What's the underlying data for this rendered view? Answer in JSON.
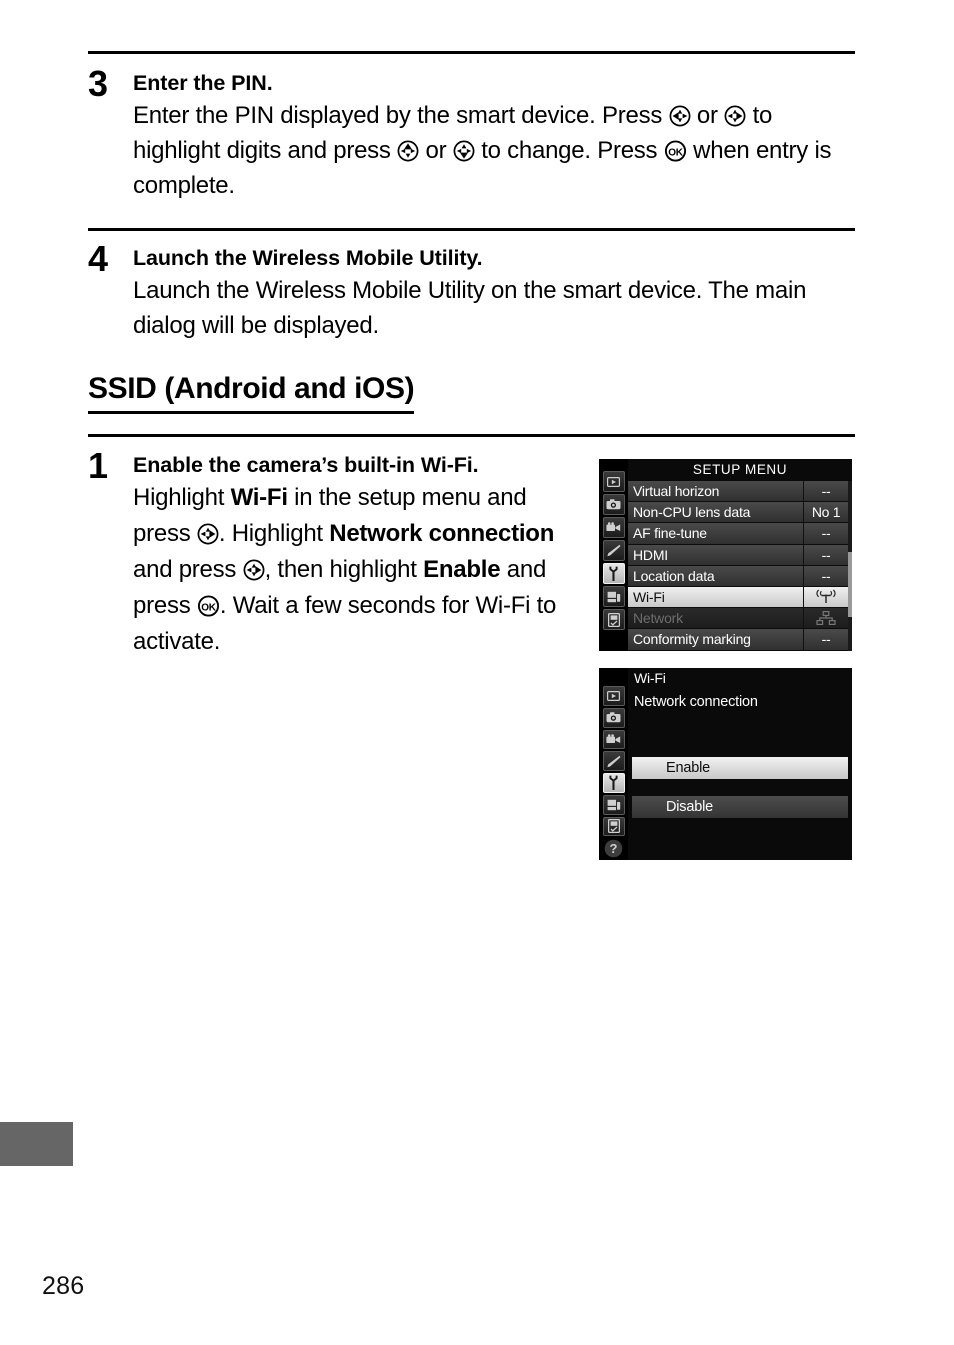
{
  "page": {
    "number": "286"
  },
  "steps": {
    "step3": {
      "number": "3",
      "title": "Enter the PIN.",
      "text_1": "Enter the PIN displayed by the smart device.  Press ",
      "text_2": " or ",
      "text_3": " to highlight digits and press ",
      "text_4": " or ",
      "text_5": " to change.  Press ",
      "text_6": " when entry is complete."
    },
    "step4": {
      "number": "4",
      "title": "Launch the Wireless Mobile Utility.",
      "text": "Launch the Wireless Mobile Utility on the smart device.  The main dialog will be displayed."
    },
    "step1": {
      "number": "1",
      "title": "Enable the camera’s built-in Wi-Fi.",
      "text_1": "Highlight ",
      "bold_1": "Wi-Fi",
      "text_2": " in the setup menu and press ",
      "text_3": ".  Highlight ",
      "bold_2": "Network connection",
      "text_4": " and press ",
      "text_5": ", then highlight ",
      "bold_3": "Enable",
      "text_6": " and press ",
      "text_7": ".  Wait a few seconds for Wi-Fi to activate."
    }
  },
  "section": {
    "ssid_heading": "SSID (Android and iOS)"
  },
  "icons": {
    "multi_selector_left": "multi-selector-left-icon",
    "multi_selector_right": "multi-selector-right-icon",
    "multi_selector_up": "multi-selector-up-icon",
    "multi_selector_down": "multi-selector-down-icon",
    "ok_button": "ok-button-icon",
    "playback": "playback-icon",
    "photo_shooting": "camera-icon",
    "movie_shooting": "movie-camera-icon",
    "custom_settings": "pencil-icon",
    "setup": "wrench-icon",
    "retouch": "paintbrush-icon",
    "recent_settings": "recent-settings-icon",
    "help": "question-mark-icon",
    "wifi_antenna": "wifi-antenna-icon",
    "network_tree": "network-tree-icon"
  },
  "lcd_setup_menu": {
    "title": "SETUP MENU",
    "rows": [
      {
        "label": "Virtual horizon",
        "value": "--",
        "state": "normal"
      },
      {
        "label": "Non-CPU lens data",
        "value": "No 1",
        "state": "normal"
      },
      {
        "label": "AF fine-tune",
        "value": "--",
        "state": "normal"
      },
      {
        "label": "HDMI",
        "value": "--",
        "state": "normal"
      },
      {
        "label": "Location data",
        "value": "--",
        "state": "normal"
      },
      {
        "label": "Wi-Fi",
        "value": "",
        "state": "selected"
      },
      {
        "label": "Network",
        "value": "",
        "state": "dim"
      },
      {
        "label": "Conformity marking",
        "value": "--",
        "state": "normal"
      }
    ],
    "rail": [
      "playback-icon",
      "camera-icon",
      "movie-camera-icon",
      "pencil-icon",
      "wrench-icon",
      "paintbrush-icon",
      "recent-settings-icon"
    ]
  },
  "lcd_wifi_menu": {
    "header": "Wi-Fi",
    "subheader": "Network connection",
    "option_enable": "Enable",
    "option_disable": "Disable",
    "rail": [
      "playback-icon",
      "camera-icon",
      "movie-camera-icon",
      "pencil-icon",
      "wrench-icon",
      "paintbrush-icon",
      "recent-settings-icon",
      "question-mark-icon"
    ]
  },
  "colors": {
    "edge_tab": "#666666",
    "lcd_background": "#0a0a0a",
    "selected_row": "#e9e9e9",
    "dim_text": "#6d6d6d"
  }
}
